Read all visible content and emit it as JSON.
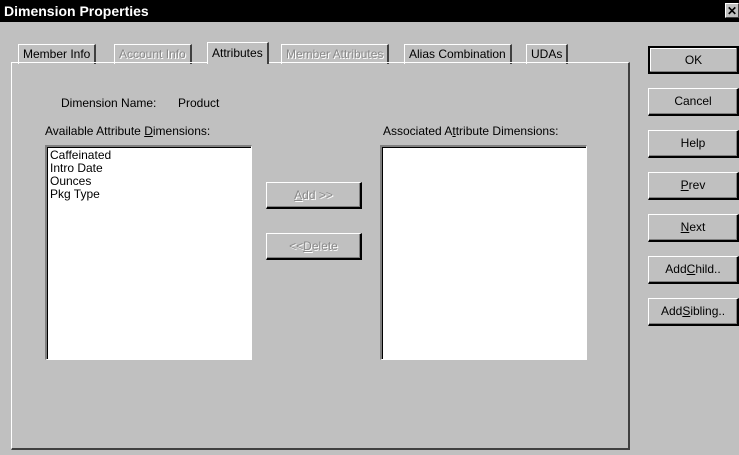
{
  "window": {
    "title": "Dimension Properties",
    "close_glyph": "✕"
  },
  "tabs": [
    {
      "label": "Member Info",
      "state": "normal"
    },
    {
      "label": "Account Info",
      "state": "disabled"
    },
    {
      "label": "Attributes",
      "state": "active"
    },
    {
      "label": "Member Attributes",
      "state": "disabled"
    },
    {
      "label": "Alias Combination",
      "state": "normal"
    },
    {
      "label": "UDAs",
      "state": "normal"
    }
  ],
  "attributes_page": {
    "dimension_name_label": "Dimension Name:",
    "dimension_name_value": "Product",
    "available_label_pre": "Available Attribute ",
    "available_label_mnemonic": "D",
    "available_label_post": "imensions:",
    "available_items": [
      "Caffeinated",
      "Intro Date",
      "Ounces",
      "Pkg Type"
    ],
    "associated_label_pre": "Associated A",
    "associated_label_mnemonic": "t",
    "associated_label_post": "tribute Dimensions:",
    "associated_items": [],
    "add_button": {
      "pre": "",
      "mnemonic": "A",
      "post": "dd >>",
      "enabled": false
    },
    "delete_button": {
      "pre": "<< ",
      "mnemonic": "D",
      "post": "elete",
      "enabled": false
    }
  },
  "side_buttons": {
    "ok": {
      "label": "OK"
    },
    "cancel": {
      "label": "Cancel"
    },
    "help": {
      "label": "Help"
    },
    "prev": {
      "pre": "",
      "mnemonic": "P",
      "post": "rev"
    },
    "next": {
      "pre": "",
      "mnemonic": "N",
      "post": "ext"
    },
    "add_child": {
      "pre": "Add ",
      "mnemonic": "C",
      "post": "hild.."
    },
    "add_sibling": {
      "pre": "Add ",
      "mnemonic": "S",
      "post": "ibling.."
    }
  }
}
